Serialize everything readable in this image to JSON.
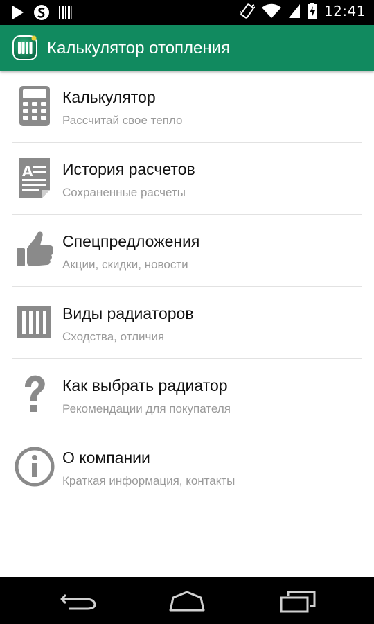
{
  "status_bar": {
    "time": "12:41",
    "left_icons": [
      "play-store-icon",
      "s-app-icon",
      "barcode-icon"
    ],
    "right_icons": [
      "vibrate-icon",
      "wifi-icon",
      "signal-icon",
      "battery-charging-icon"
    ]
  },
  "app_bar": {
    "title": "Калькулятор отопления",
    "logo_icon": "radiator-logo-icon",
    "color": "#118a5f"
  },
  "menu": {
    "items": [
      {
        "icon": "calculator-icon",
        "title": "Калькулятор",
        "subtitle": "Рассчитай свое тепло"
      },
      {
        "icon": "document-history-icon",
        "title": "История расчетов",
        "subtitle": "Сохраненные расчеты"
      },
      {
        "icon": "thumbs-up-icon",
        "title": "Спецпредложения",
        "subtitle": "Акции, скидки, новости"
      },
      {
        "icon": "radiator-icon",
        "title": "Виды радиаторов",
        "subtitle": "Сходства, отличия"
      },
      {
        "icon": "question-icon",
        "title": "Как выбрать радиатор",
        "subtitle": "Рекомендации для покупателя"
      },
      {
        "icon": "info-icon",
        "title": "О компании",
        "subtitle": "Краткая информация, контакты"
      }
    ]
  },
  "nav_bar": {
    "buttons": [
      "back-icon",
      "home-icon",
      "recents-icon"
    ]
  },
  "colors": {
    "icon_gray": "#8a8a8a",
    "title_text": "#111111",
    "subtitle_text": "#9a9a9a"
  }
}
